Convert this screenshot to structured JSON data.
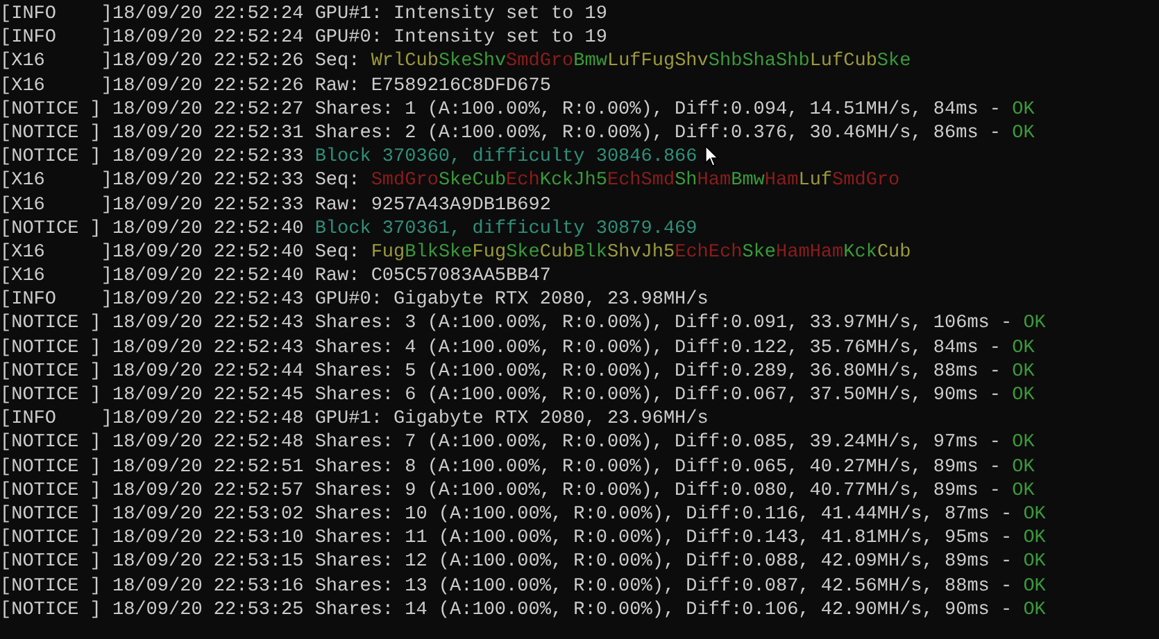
{
  "lines": [
    {
      "tag": "[INFO    ]",
      "time": "18/09/20 22:52:24",
      "segments": [
        {
          "text": "GPU#1: Intensity set to 19",
          "color": "#cccccc"
        }
      ]
    },
    {
      "tag": "[INFO    ]",
      "time": "18/09/20 22:52:24",
      "segments": [
        {
          "text": "GPU#0: Intensity set to 19",
          "color": "#cccccc"
        }
      ]
    },
    {
      "tag": "[X16     ]",
      "time": "18/09/20 22:52:26",
      "segments": [
        {
          "text": "Seq: ",
          "color": "#cccccc"
        },
        {
          "text": "WrlCub",
          "color": "#9c9a3c"
        },
        {
          "text": "SkeShv",
          "color": "#3a9a3a"
        },
        {
          "text": "SmdGro",
          "color": "#8c1c1c"
        },
        {
          "text": "Bmw",
          "color": "#3a9a3a"
        },
        {
          "text": "LufFugShv",
          "color": "#9c9a3c"
        },
        {
          "text": "ShbShaShb",
          "color": "#3a9a3a"
        },
        {
          "text": "LufCub",
          "color": "#9c9a3c"
        },
        {
          "text": "Ske",
          "color": "#3a9a3a"
        }
      ]
    },
    {
      "tag": "[X16     ]",
      "time": "18/09/20 22:52:26",
      "segments": [
        {
          "text": "Raw: E7589216C8DFD675",
          "color": "#cccccc"
        }
      ]
    },
    {
      "tag": "[NOTICE ]",
      "time": "18/09/20 22:52:27",
      "segments": [
        {
          "text": "Shares: 1 (A:100.00%, R:0.00%), Diff:0.094, 14.51MH/s, 84ms - ",
          "color": "#cccccc"
        },
        {
          "text": "OK",
          "color": "#3a9a3a"
        }
      ]
    },
    {
      "tag": "[NOTICE ]",
      "time": "18/09/20 22:52:31",
      "segments": [
        {
          "text": "Shares: 2 (A:100.00%, R:0.00%), Diff:0.376, 30.46MH/s, 86ms - ",
          "color": "#cccccc"
        },
        {
          "text": "OK",
          "color": "#3a9a3a"
        }
      ]
    },
    {
      "tag": "[NOTICE ]",
      "time": "18/09/20 22:52:33",
      "segments": [
        {
          "text": "Block 370360, difficulty 30846.866",
          "color": "#2f9078"
        }
      ]
    },
    {
      "tag": "[X16     ]",
      "time": "18/09/20 22:52:33",
      "segments": [
        {
          "text": "Seq: ",
          "color": "#cccccc"
        },
        {
          "text": "SmdGro",
          "color": "#8c1c1c"
        },
        {
          "text": "SkeCub",
          "color": "#3a9a3a"
        },
        {
          "text": "Ech",
          "color": "#8c1c1c"
        },
        {
          "text": "KckJh5",
          "color": "#3a9a3a"
        },
        {
          "text": "EchSmd",
          "color": "#8c1c1c"
        },
        {
          "text": "Sh",
          "color": "#3a9a3a"
        },
        {
          "text": "Ham",
          "color": "#8c1c1c"
        },
        {
          "text": "Bmw",
          "color": "#3a9a3a"
        },
        {
          "text": "Ham",
          "color": "#8c1c1c"
        },
        {
          "text": "Luf",
          "color": "#9c9a3c"
        },
        {
          "text": "SmdGro",
          "color": "#8c1c1c"
        }
      ]
    },
    {
      "tag": "[X16     ]",
      "time": "18/09/20 22:52:33",
      "segments": [
        {
          "text": "Raw: 9257A43A9DB1B692",
          "color": "#cccccc"
        }
      ]
    },
    {
      "tag": "[NOTICE ]",
      "time": "18/09/20 22:52:40",
      "segments": [
        {
          "text": "Block 370361, difficulty 30879.469",
          "color": "#2f9078"
        }
      ]
    },
    {
      "tag": "[X16     ]",
      "time": "18/09/20 22:52:40",
      "segments": [
        {
          "text": "Seq: ",
          "color": "#cccccc"
        },
        {
          "text": "Fug",
          "color": "#9c9a3c"
        },
        {
          "text": "BlkSke",
          "color": "#3a9a3a"
        },
        {
          "text": "Fug",
          "color": "#9c9a3c"
        },
        {
          "text": "Ske",
          "color": "#3a9a3a"
        },
        {
          "text": "Cub",
          "color": "#9c9a3c"
        },
        {
          "text": "Blk",
          "color": "#3a9a3a"
        },
        {
          "text": "ShvJh5",
          "color": "#9c9a3c"
        },
        {
          "text": "EchEch",
          "color": "#8c1c1c"
        },
        {
          "text": "Ske",
          "color": "#3a9a3a"
        },
        {
          "text": "HamHam",
          "color": "#8c1c1c"
        },
        {
          "text": "Kck",
          "color": "#3a9a3a"
        },
        {
          "text": "Cub",
          "color": "#9c9a3c"
        }
      ]
    },
    {
      "tag": "[X16     ]",
      "time": "18/09/20 22:52:40",
      "segments": [
        {
          "text": "Raw: C05C57083AA5BB47",
          "color": "#cccccc"
        }
      ]
    },
    {
      "tag": "[INFO    ]",
      "time": "18/09/20 22:52:43",
      "segments": [
        {
          "text": "GPU#0: Gigabyte RTX 2080, 23.98MH/s",
          "color": "#cccccc"
        }
      ]
    },
    {
      "tag": "[NOTICE ]",
      "time": "18/09/20 22:52:43",
      "segments": [
        {
          "text": "Shares: 3 (A:100.00%, R:0.00%), Diff:0.091, 33.97MH/s, 106ms - ",
          "color": "#cccccc"
        },
        {
          "text": "OK",
          "color": "#3a9a3a"
        }
      ]
    },
    {
      "tag": "[NOTICE ]",
      "time": "18/09/20 22:52:43",
      "segments": [
        {
          "text": "Shares: 4 (A:100.00%, R:0.00%), Diff:0.122, 35.76MH/s, 84ms - ",
          "color": "#cccccc"
        },
        {
          "text": "OK",
          "color": "#3a9a3a"
        }
      ]
    },
    {
      "tag": "[NOTICE ]",
      "time": "18/09/20 22:52:44",
      "segments": [
        {
          "text": "Shares: 5 (A:100.00%, R:0.00%), Diff:0.289, 36.80MH/s, 88ms - ",
          "color": "#cccccc"
        },
        {
          "text": "OK",
          "color": "#3a9a3a"
        }
      ]
    },
    {
      "tag": "[NOTICE ]",
      "time": "18/09/20 22:52:45",
      "segments": [
        {
          "text": "Shares: 6 (A:100.00%, R:0.00%), Diff:0.067, 37.50MH/s, 90ms - ",
          "color": "#cccccc"
        },
        {
          "text": "OK",
          "color": "#3a9a3a"
        }
      ]
    },
    {
      "tag": "[INFO    ]",
      "time": "18/09/20 22:52:48",
      "segments": [
        {
          "text": "GPU#1: Gigabyte RTX 2080, 23.96MH/s",
          "color": "#cccccc"
        }
      ]
    },
    {
      "tag": "[NOTICE ]",
      "time": "18/09/20 22:52:48",
      "segments": [
        {
          "text": "Shares: 7 (A:100.00%, R:0.00%), Diff:0.085, 39.24MH/s, 97ms - ",
          "color": "#cccccc"
        },
        {
          "text": "OK",
          "color": "#3a9a3a"
        }
      ]
    },
    {
      "tag": "[NOTICE ]",
      "time": "18/09/20 22:52:51",
      "segments": [
        {
          "text": "Shares: 8 (A:100.00%, R:0.00%), Diff:0.065, 40.27MH/s, 89ms - ",
          "color": "#cccccc"
        },
        {
          "text": "OK",
          "color": "#3a9a3a"
        }
      ]
    },
    {
      "tag": "[NOTICE ]",
      "time": "18/09/20 22:52:57",
      "segments": [
        {
          "text": "Shares: 9 (A:100.00%, R:0.00%), Diff:0.080, 40.77MH/s, 89ms - ",
          "color": "#cccccc"
        },
        {
          "text": "OK",
          "color": "#3a9a3a"
        }
      ]
    },
    {
      "tag": "[NOTICE ]",
      "time": "18/09/20 22:53:02",
      "segments": [
        {
          "text": "Shares: 10 (A:100.00%, R:0.00%), Diff:0.116, 41.44MH/s, 87ms - ",
          "color": "#cccccc"
        },
        {
          "text": "OK",
          "color": "#3a9a3a"
        }
      ]
    },
    {
      "tag": "[NOTICE ]",
      "time": "18/09/20 22:53:10",
      "segments": [
        {
          "text": "Shares: 11 (A:100.00%, R:0.00%), Diff:0.143, 41.81MH/s, 95ms - ",
          "color": "#cccccc"
        },
        {
          "text": "OK",
          "color": "#3a9a3a"
        }
      ]
    },
    {
      "tag": "[NOTICE ]",
      "time": "18/09/20 22:53:15",
      "segments": [
        {
          "text": "Shares: 12 (A:100.00%, R:0.00%), Diff:0.088, 42.09MH/s, 89ms - ",
          "color": "#cccccc"
        },
        {
          "text": "OK",
          "color": "#3a9a3a"
        }
      ]
    },
    {
      "tag": "[NOTICE ]",
      "time": "18/09/20 22:53:16",
      "segments": [
        {
          "text": "Shares: 13 (A:100.00%, R:0.00%), Diff:0.087, 42.56MH/s, 88ms - ",
          "color": "#cccccc"
        },
        {
          "text": "OK",
          "color": "#3a9a3a"
        }
      ]
    },
    {
      "tag": "[NOTICE ]",
      "time": "18/09/20 22:53:25",
      "segments": [
        {
          "text": "Shares: 14 (A:100.00%, R:0.00%), Diff:0.106, 42.90MH/s, 90ms - ",
          "color": "#cccccc"
        },
        {
          "text": "OK",
          "color": "#3a9a3a"
        }
      ]
    }
  ]
}
